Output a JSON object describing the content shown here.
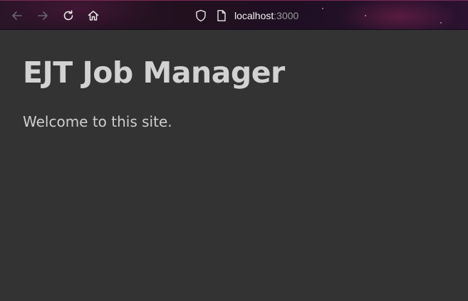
{
  "browser": {
    "url_host": "localhost",
    "url_port": ":3000",
    "icons": {
      "back": "arrow-left-icon",
      "forward": "arrow-right-icon",
      "reload": "reload-icon",
      "home": "home-icon",
      "security": "shield-icon",
      "page": "page-icon"
    },
    "accent_color": "#7a2a55"
  },
  "page": {
    "title": "EJT Job Manager",
    "welcome_text": "Welcome to this site."
  }
}
